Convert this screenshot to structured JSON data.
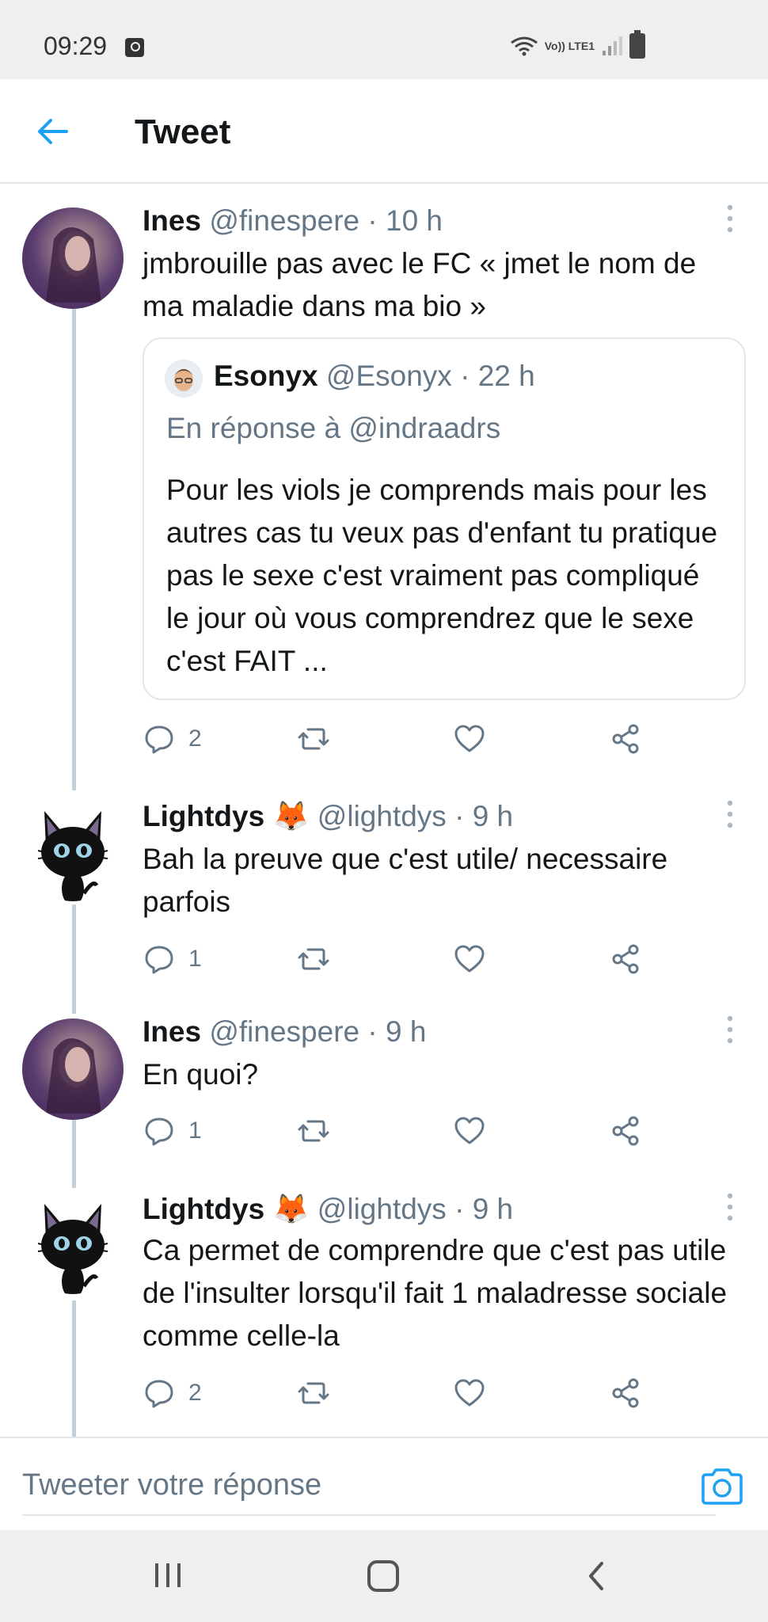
{
  "status_bar": {
    "time": "09:29",
    "network_label": "Vo)) LTE1"
  },
  "header": {
    "title": "Tweet"
  },
  "colors": {
    "accent": "#1da1f2",
    "text": "#14171a",
    "muted": "#657786",
    "divider": "#e1e8ed"
  },
  "tweets": [
    {
      "name": "Ines",
      "handle": "@finespere",
      "separator": "·",
      "time": "10 h",
      "text": "jmbrouille pas avec le FC « jmet le nom de ma maladie dans ma bio »",
      "reply_count": "2",
      "quote": {
        "name": "Esonyx",
        "handle": "@Esonyx",
        "separator": "·",
        "time": "22 h",
        "reply_to": "En réponse à @indraadrs",
        "text": "Pour les viols je comprends mais pour les autres cas tu veux pas d'enfant tu pratique pas le sexe c'est vraiment pas compliqué le jour où vous comprendrez que le sexe c'est FAIT ..."
      }
    },
    {
      "name": "Lightdys 🦊",
      "handle": "@lightdys",
      "separator": "·",
      "time": "9 h",
      "text": "Bah la preuve que c'est utile/ necessaire parfois",
      "reply_count": "1"
    },
    {
      "name": "Ines",
      "handle": "@finespere",
      "separator": "·",
      "time": "9 h",
      "text": "En quoi?",
      "reply_count": "1"
    },
    {
      "name": "Lightdys 🦊",
      "handle": "@lightdys",
      "separator": "·",
      "time": "9 h",
      "text": "Ca permet de comprendre que c'est pas utile de l'insulter lorsqu'il fait 1 maladresse sociale comme celle-la",
      "reply_count": "2"
    }
  ],
  "reply_bar": {
    "placeholder": "Tweeter votre réponse"
  }
}
